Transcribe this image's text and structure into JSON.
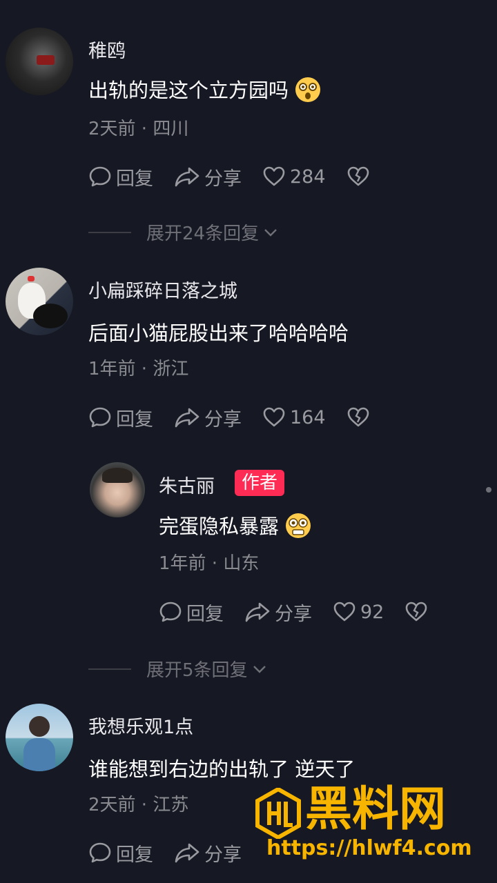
{
  "actions": {
    "reply": "回复",
    "share": "分享"
  },
  "comments": [
    {
      "username": "稚鸥",
      "text": "出轨的是这个立方园吗",
      "time": "2天前",
      "location": "四川",
      "likes": "284",
      "expand": "展开24条回复"
    },
    {
      "username": "小扁踩碎日落之城",
      "text": "后面小猫屁股出来了哈哈哈哈",
      "time": "1年前",
      "location": "浙江",
      "likes": "164"
    },
    {
      "username": "朱古丽",
      "badge": "作者",
      "text": "完蛋隐私暴露",
      "time": "1年前",
      "location": "山东",
      "likes": "92",
      "expand": "展开5条回复"
    },
    {
      "username": "我想乐观1点",
      "text": "谁能想到右边的出轨了 逆天了",
      "time": "2天前",
      "location": "江苏"
    }
  ],
  "watermark": {
    "brand": "黑料网",
    "url": "https://hlwf4.com"
  },
  "colors": {
    "background": "#161823",
    "badge": "#fe2c55",
    "watermark": "#f7b500"
  }
}
